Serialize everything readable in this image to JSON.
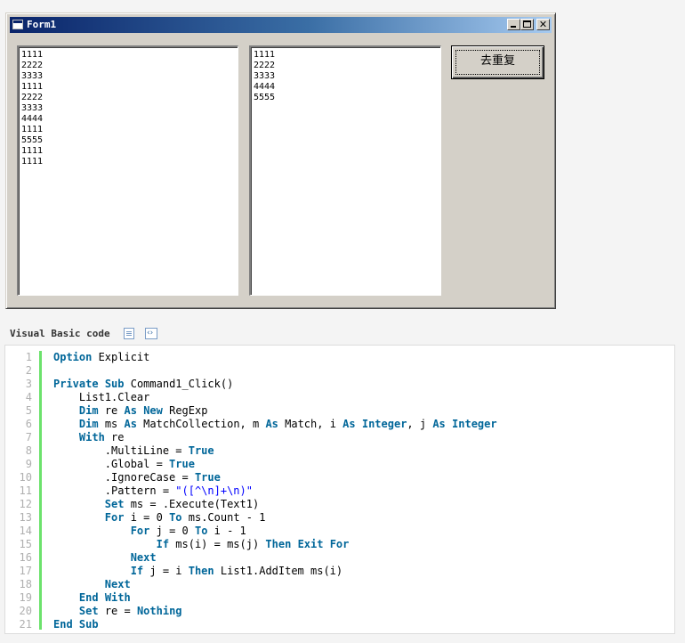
{
  "window": {
    "title": "Form1",
    "textbox1_lines": [
      "1111",
      "2222",
      "3333",
      "1111",
      "2222",
      "3333",
      "4444",
      "1111",
      "5555",
      "1111",
      "1111"
    ],
    "textbox2_lines": [
      "1111",
      "2222",
      "3333",
      "4444",
      "5555"
    ],
    "command_button_label": "去重复"
  },
  "code_section": {
    "header_label": "Visual Basic code",
    "lines": [
      [
        {
          "t": "Option",
          "k": 1
        },
        {
          "t": " Explicit"
        }
      ],
      [],
      [
        {
          "t": "Private",
          "k": 1
        },
        {
          "t": " "
        },
        {
          "t": "Sub",
          "k": 1
        },
        {
          "t": " Command1_Click()"
        }
      ],
      [
        {
          "t": "    List1.Clear"
        }
      ],
      [
        {
          "t": "    "
        },
        {
          "t": "Dim",
          "k": 1
        },
        {
          "t": " re "
        },
        {
          "t": "As",
          "k": 1
        },
        {
          "t": " "
        },
        {
          "t": "New",
          "k": 1
        },
        {
          "t": " RegExp"
        }
      ],
      [
        {
          "t": "    "
        },
        {
          "t": "Dim",
          "k": 1
        },
        {
          "t": " ms "
        },
        {
          "t": "As",
          "k": 1
        },
        {
          "t": " MatchCollection, m "
        },
        {
          "t": "As",
          "k": 1
        },
        {
          "t": " Match, i "
        },
        {
          "t": "As",
          "k": 1
        },
        {
          "t": " "
        },
        {
          "t": "Integer",
          "k": 1
        },
        {
          "t": ", j "
        },
        {
          "t": "As",
          "k": 1
        },
        {
          "t": " "
        },
        {
          "t": "Integer",
          "k": 1
        }
      ],
      [
        {
          "t": "    "
        },
        {
          "t": "With",
          "k": 1
        },
        {
          "t": " re"
        }
      ],
      [
        {
          "t": "        .MultiLine = "
        },
        {
          "t": "True",
          "k": 1
        }
      ],
      [
        {
          "t": "        .Global = "
        },
        {
          "t": "True",
          "k": 1
        }
      ],
      [
        {
          "t": "        .IgnoreCase = "
        },
        {
          "t": "True",
          "k": 1
        }
      ],
      [
        {
          "t": "        .Pattern = "
        },
        {
          "t": "\"([^\\n]+\\n)\"",
          "s": 1
        }
      ],
      [
        {
          "t": "        "
        },
        {
          "t": "Set",
          "k": 1
        },
        {
          "t": " ms = .Execute(Text1)"
        }
      ],
      [
        {
          "t": "        "
        },
        {
          "t": "For",
          "k": 1
        },
        {
          "t": " i = 0 "
        },
        {
          "t": "To",
          "k": 1
        },
        {
          "t": " ms.Count - 1"
        }
      ],
      [
        {
          "t": "            "
        },
        {
          "t": "For",
          "k": 1
        },
        {
          "t": " j = 0 "
        },
        {
          "t": "To",
          "k": 1
        },
        {
          "t": " i - 1"
        }
      ],
      [
        {
          "t": "                "
        },
        {
          "t": "If",
          "k": 1
        },
        {
          "t": " ms(i) = ms(j) "
        },
        {
          "t": "Then",
          "k": 1
        },
        {
          "t": " "
        },
        {
          "t": "Exit",
          "k": 1
        },
        {
          "t": " "
        },
        {
          "t": "For",
          "k": 1
        }
      ],
      [
        {
          "t": "            "
        },
        {
          "t": "Next",
          "k": 1
        }
      ],
      [
        {
          "t": "            "
        },
        {
          "t": "If",
          "k": 1
        },
        {
          "t": " j = i "
        },
        {
          "t": "Then",
          "k": 1
        },
        {
          "t": " List1.AddItem ms(i)"
        }
      ],
      [
        {
          "t": "        "
        },
        {
          "t": "Next",
          "k": 1
        }
      ],
      [
        {
          "t": "    "
        },
        {
          "t": "End",
          "k": 1
        },
        {
          "t": " "
        },
        {
          "t": "With",
          "k": 1
        }
      ],
      [
        {
          "t": "    "
        },
        {
          "t": "Set",
          "k": 1
        },
        {
          "t": " re = "
        },
        {
          "t": "Nothing",
          "k": 1
        }
      ],
      [
        {
          "t": "End",
          "k": 1
        },
        {
          "t": " "
        },
        {
          "t": "Sub",
          "k": 1
        }
      ]
    ]
  },
  "colors": {
    "keyword": "#006699",
    "string": "#0000ff",
    "gutter_bar": "#6ce26c",
    "titlebar_start": "#0a246a",
    "titlebar_end": "#a6caf0",
    "window_face": "#d4d0c8"
  },
  "icons": {
    "window": "form-icon",
    "copy": "copy-code-icon",
    "view_source": "view-source-icon"
  }
}
